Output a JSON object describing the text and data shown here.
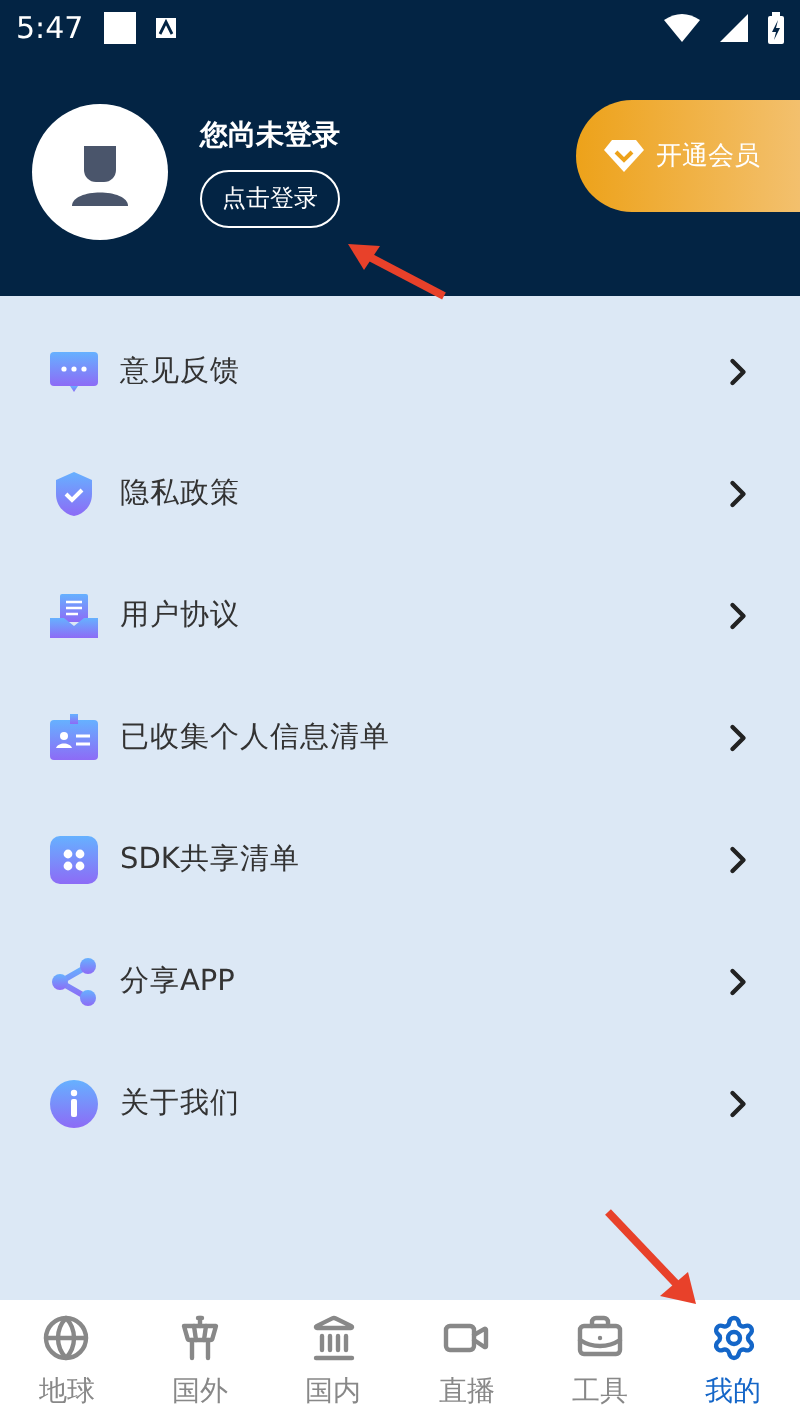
{
  "status_bar": {
    "time": "5:47"
  },
  "profile": {
    "title": "您尚未登录",
    "login_button": "点击登录"
  },
  "vip_button": {
    "label": "开通会员"
  },
  "menu": [
    {
      "kind": "feedback",
      "label": "意见反馈"
    },
    {
      "kind": "privacy",
      "label": "隐私政策"
    },
    {
      "kind": "agreement",
      "label": "用户协议"
    },
    {
      "kind": "info",
      "label": "已收集个人信息清单"
    },
    {
      "kind": "sdk",
      "label": "SDK共享清单"
    },
    {
      "kind": "share",
      "label": "分享APP"
    },
    {
      "kind": "about",
      "label": "关于我们"
    }
  ],
  "tabs": [
    {
      "kind": "globe",
      "label": "地球",
      "selected": false
    },
    {
      "kind": "tower",
      "label": "国外",
      "selected": false
    },
    {
      "kind": "gate",
      "label": "国内",
      "selected": false
    },
    {
      "kind": "live",
      "label": "直播",
      "selected": false
    },
    {
      "kind": "tools",
      "label": "工具",
      "selected": false
    },
    {
      "kind": "mine",
      "label": "我的",
      "selected": true
    }
  ]
}
